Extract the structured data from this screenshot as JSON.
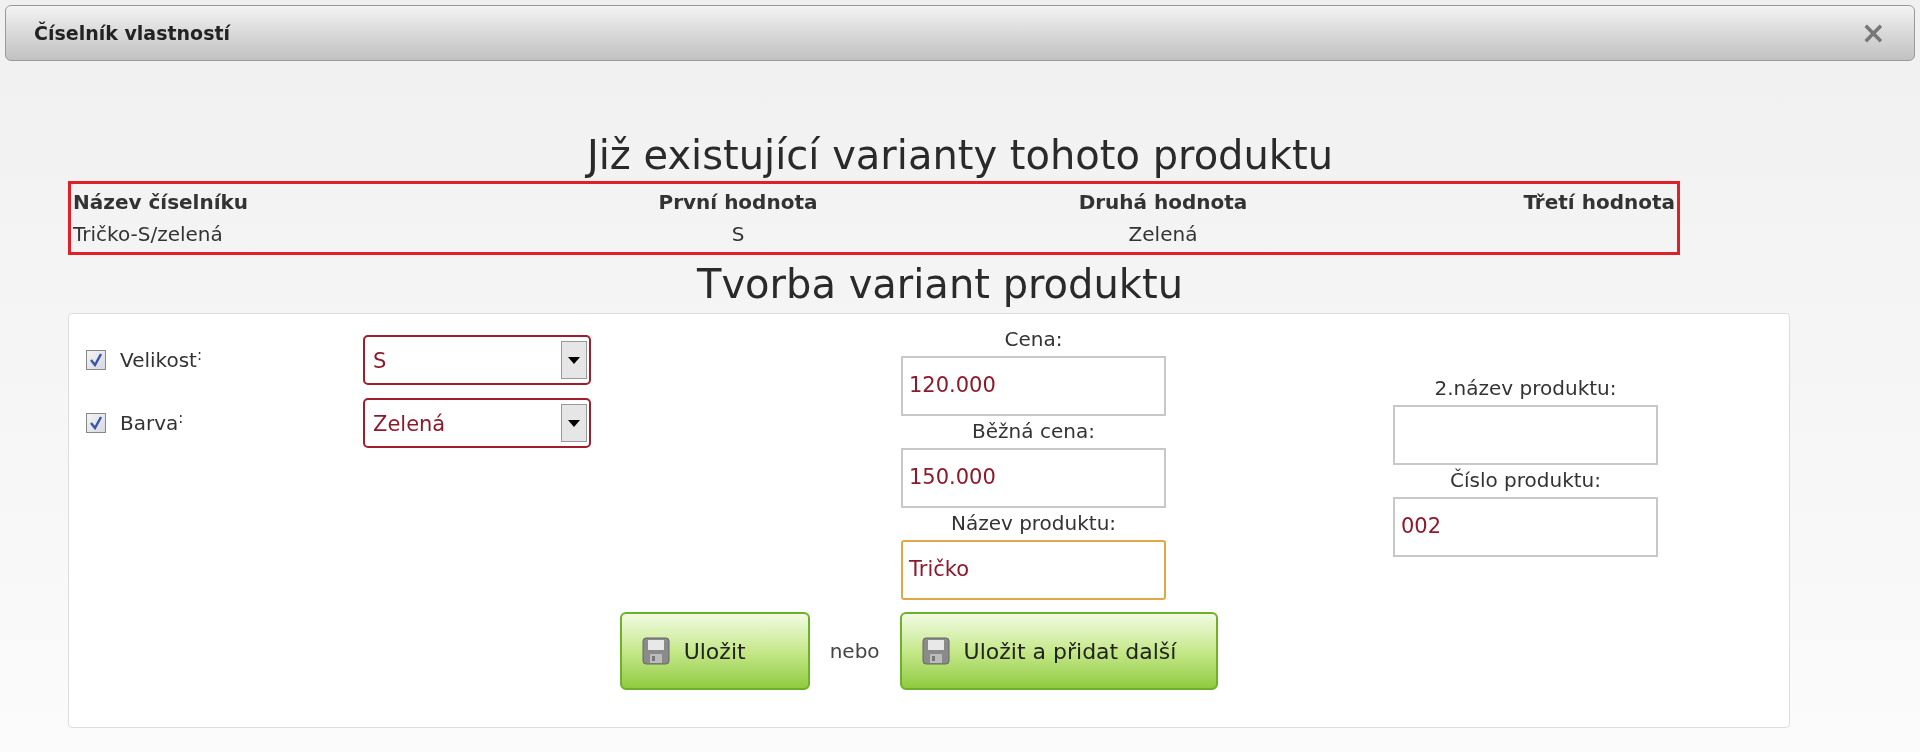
{
  "window": {
    "title": "Číselník vlastností",
    "close": "×"
  },
  "existing": {
    "heading": "Již existující varianty tohoto produktu",
    "columns": [
      "Název číselníku",
      "První hodnota",
      "Druhá hodnota",
      "Třetí hodnota"
    ],
    "rows": [
      {
        "cells": [
          "Tričko-S/zelená",
          "S",
          "Zelená"
        ]
      }
    ]
  },
  "form": {
    "heading": "Tvorba variant produktu",
    "properties": [
      {
        "label": "Velikost$^{:}$",
        "checked": true,
        "value": "S"
      },
      {
        "label": "Barva$^{:}$",
        "checked": true,
        "value": "Zelená"
      }
    ],
    "price_fields": [
      {
        "label": "Cena:",
        "value": "120.000",
        "focused": false
      },
      {
        "label": "Běžná cena:",
        "value": "150.000",
        "focused": false
      },
      {
        "label": "Název produktu:",
        "value": "Tričko",
        "focused": true
      }
    ],
    "product_fields": [
      {
        "label": "2.název produktu:",
        "focused": false
      },
      {
        "label": "Číslo produktu:",
        "value": "002",
        "focused": false
      }
    ],
    "buttons": [
      {
        "label": "Uložit"
      },
      {
        "label": "Uložit a přidat další"
      }
    ],
    "separator": "nebo"
  }
}
